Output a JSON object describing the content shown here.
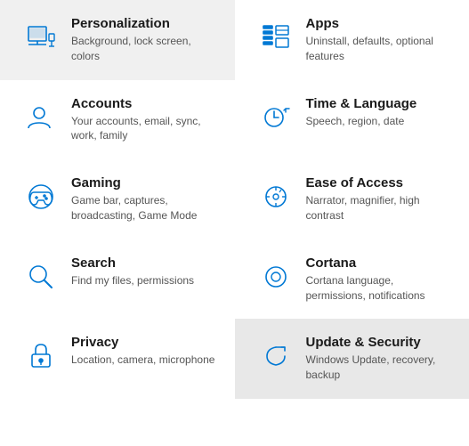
{
  "items": [
    {
      "id": "personalization",
      "title": "Personalization",
      "desc": "Background, lock screen, colors",
      "icon": "personalization",
      "active": false
    },
    {
      "id": "apps",
      "title": "Apps",
      "desc": "Uninstall, defaults, optional features",
      "icon": "apps",
      "active": false
    },
    {
      "id": "accounts",
      "title": "Accounts",
      "desc": "Your accounts, email, sync, work, family",
      "icon": "accounts",
      "active": false
    },
    {
      "id": "time-language",
      "title": "Time & Language",
      "desc": "Speech, region, date",
      "icon": "time",
      "active": false
    },
    {
      "id": "gaming",
      "title": "Gaming",
      "desc": "Game bar, captures, broadcasting, Game Mode",
      "icon": "gaming",
      "active": false
    },
    {
      "id": "ease-of-access",
      "title": "Ease of Access",
      "desc": "Narrator, magnifier, high contrast",
      "icon": "ease",
      "active": false
    },
    {
      "id": "search",
      "title": "Search",
      "desc": "Find my files, permissions",
      "icon": "search",
      "active": false
    },
    {
      "id": "cortana",
      "title": "Cortana",
      "desc": "Cortana language, permissions, notifications",
      "icon": "cortana",
      "active": false
    },
    {
      "id": "privacy",
      "title": "Privacy",
      "desc": "Location, camera, microphone",
      "icon": "privacy",
      "active": false
    },
    {
      "id": "update-security",
      "title": "Update & Security",
      "desc": "Windows Update, recovery, backup",
      "icon": "update",
      "active": true
    }
  ]
}
